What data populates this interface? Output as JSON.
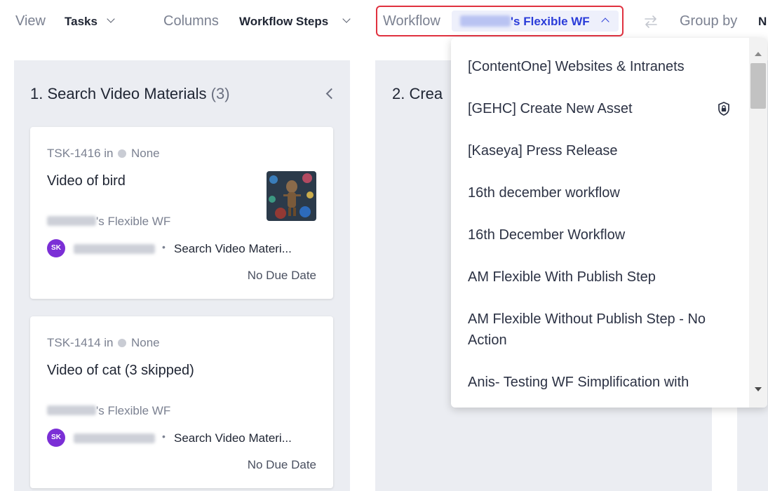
{
  "toolbar": {
    "view_label": "View",
    "view_value": "Tasks",
    "columns_label": "Columns",
    "columns_value": "Workflow Steps",
    "workflow_label": "Workflow",
    "workflow_value": "'s Flexible WF",
    "groupby_label": "Group by",
    "groupby_value": "N"
  },
  "columns": [
    {
      "title": "1. Search Video Materials",
      "count": "(3)"
    },
    {
      "title": "2. Crea"
    }
  ],
  "cards": [
    {
      "id_prefix": "TSK-1416 in",
      "status": "None",
      "title": "Video of bird",
      "workflow": "'s Flexible WF",
      "avatar": "SK",
      "step": "Search Video Materi...",
      "due": "No Due Date"
    },
    {
      "id_prefix": "TSK-1414 in",
      "status": "None",
      "title": "Video of cat (3 skipped)",
      "workflow": "'s Flexible WF",
      "avatar": "SK",
      "step": "Search Video Materi...",
      "due": "No Due Date"
    }
  ],
  "dropdown": {
    "items": [
      "[ContentOne] Websites & Intranets",
      "[GEHC] Create New Asset",
      "[Kaseya] Press Release",
      "16th december workflow",
      "16th December Workflow",
      "AM Flexible With Publish Step",
      "AM Flexible Without Publish Step - No Action",
      "Anis- Testing WF Simplification with"
    ]
  },
  "colors": {
    "accent": "#2a3cd9",
    "highlight_border": "#e0313f",
    "avatar": "#7b2fd6",
    "column_bg": "#ebedf2"
  },
  "icons": [
    "chevron-down-icon",
    "chevron-up-icon",
    "swap-arrows-icon",
    "chevron-left-icon",
    "lock-shield-icon",
    "scroll-up-icon",
    "scroll-down-icon"
  ]
}
